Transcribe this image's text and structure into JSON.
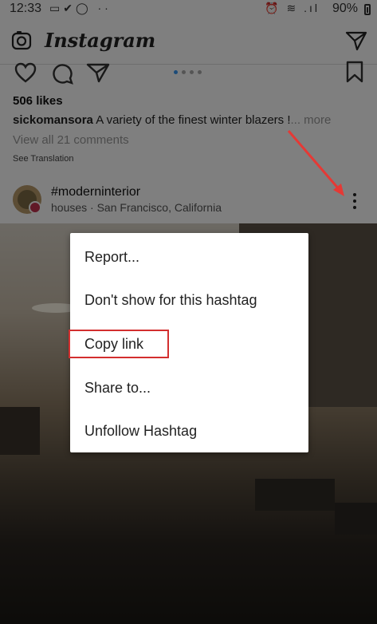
{
  "status_bar": {
    "time": "12:33",
    "battery": "90%"
  },
  "header": {
    "app_name": "Instagram"
  },
  "post": {
    "likes": "506 likes",
    "caption_user": "sickomansora",
    "caption_text": " A variety of the finest winter blazers !",
    "caption_more": "... more",
    "view_comments": "View all 21 comments",
    "see_translation": "See Translation"
  },
  "next_post": {
    "hashtag": "#moderninterior",
    "location": "houses · San Francisco, California"
  },
  "menu": {
    "items": [
      "Report...",
      "Don't show for this hashtag",
      "Copy link",
      "Share to...",
      "Unfollow Hashtag"
    ]
  },
  "colors": {
    "highlight": "#d32f2f",
    "arrow": "#e53935",
    "page_dot_active": "#3897f0"
  }
}
